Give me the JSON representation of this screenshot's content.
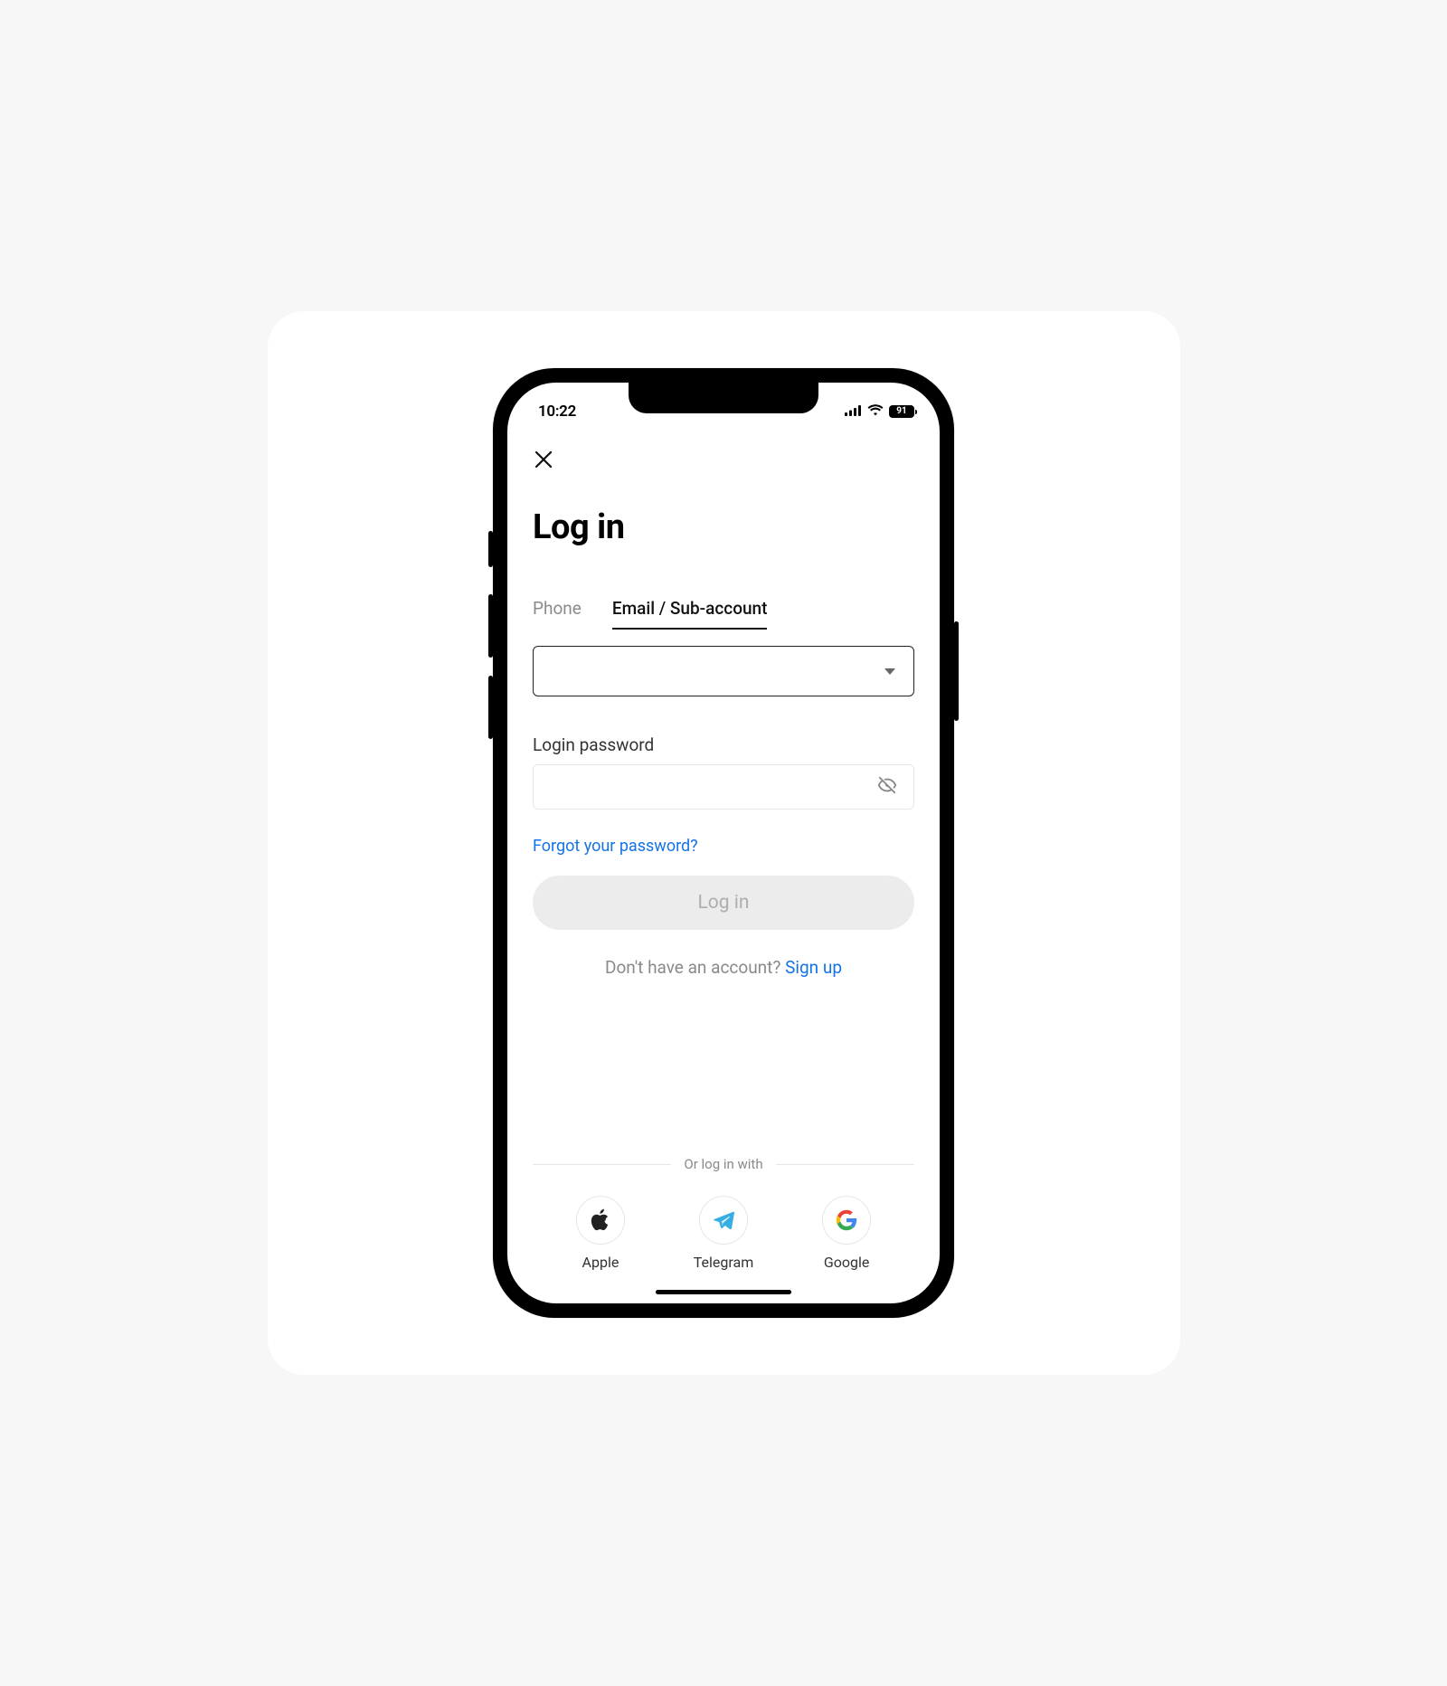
{
  "status": {
    "time": "10:22",
    "battery": "91"
  },
  "header": {
    "title": "Log in"
  },
  "tabs": {
    "phone": "Phone",
    "email": "Email / Sub-account"
  },
  "password": {
    "label": "Login password"
  },
  "links": {
    "forgot": "Forgot your password?",
    "signup_prompt": "Don't have an account? ",
    "signup": "Sign up"
  },
  "buttons": {
    "login": "Log in"
  },
  "divider": {
    "text": "Or log in with"
  },
  "social": {
    "apple": "Apple",
    "telegram": "Telegram",
    "google": "Google"
  }
}
